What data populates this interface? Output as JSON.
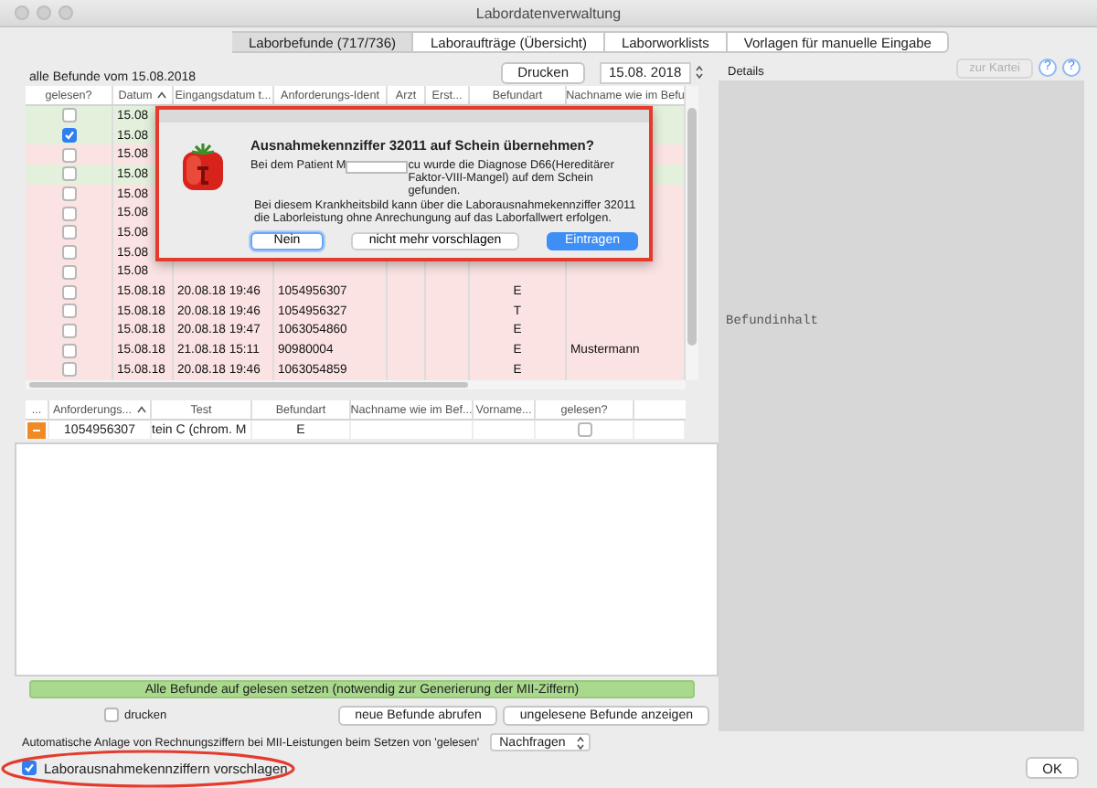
{
  "window": {
    "title": "Labordatenverwaltung"
  },
  "tabs": [
    {
      "label": "Laborbefunde (717/736)",
      "selected": true
    },
    {
      "label": "Laboraufträge (Übersicht)",
      "selected": false
    },
    {
      "label": "Laborworklists",
      "selected": false
    },
    {
      "label": "Vorlagen für manuelle Eingabe",
      "selected": false
    }
  ],
  "results_header": {
    "label": "alle Befunde vom 15.08.2018",
    "print_button": "Drucken",
    "date": "15.08. 2018"
  },
  "results_table": {
    "columns": [
      {
        "label": "gelesen?",
        "sorted": false
      },
      {
        "label": "Datum",
        "sorted": true
      },
      {
        "label": "Eingangsdatum t...",
        "sorted": false
      },
      {
        "label": "Anforderungs-Ident",
        "sorted": false
      },
      {
        "label": "Arzt",
        "sorted": false
      },
      {
        "label": "Erst...",
        "sorted": false
      },
      {
        "label": "Befundart",
        "sorted": false
      },
      {
        "label": "Nachname wie im Befu",
        "sorted": false
      }
    ],
    "rows": [
      {
        "checked": false,
        "color": "#e3f1dc",
        "datum": "15.08"
      },
      {
        "checked": true,
        "color": "#e3f1dc",
        "datum": "15.08"
      },
      {
        "checked": false,
        "color": "#fbe3e3",
        "datum": "15.08"
      },
      {
        "checked": false,
        "color": "#e3f1dc",
        "datum": "15.08"
      },
      {
        "checked": false,
        "color": "#fbe3e3",
        "datum": "15.08"
      },
      {
        "checked": false,
        "color": "#fbe3e3",
        "datum": "15.08"
      },
      {
        "checked": false,
        "color": "#fbe3e3",
        "datum": "15.08"
      },
      {
        "checked": false,
        "color": "#fbe3e3",
        "datum": "15.08"
      },
      {
        "checked": false,
        "color": "#fbe3e3",
        "datum": "15.08"
      },
      {
        "checked": false,
        "color": "#fbe3e3",
        "datum": "15.08.18",
        "eingang": "20.08.18 19:46",
        "ident": "1054956307",
        "befundart": "E"
      },
      {
        "checked": false,
        "color": "#fbe3e3",
        "datum": "15.08.18",
        "eingang": "20.08.18 19:46",
        "ident": "1054956327",
        "befundart": "T"
      },
      {
        "checked": false,
        "color": "#fbe3e3",
        "datum": "15.08.18",
        "eingang": "20.08.18 19:47",
        "ident": "1063054860",
        "befundart": "E"
      },
      {
        "checked": false,
        "color": "#fbe3e3",
        "datum": "15.08.18",
        "eingang": "21.08.18 15:11",
        "ident": "90980004",
        "befundart": "E",
        "nachname": "Mustermann"
      },
      {
        "checked": false,
        "color": "#fbe3e3",
        "datum": "15.08.18",
        "eingang": "20.08.18 19:46",
        "ident": "1063054859",
        "befundart": "E"
      }
    ]
  },
  "orders_table": {
    "columns": [
      {
        "label": "...",
        "sorted": false
      },
      {
        "label": "Anforderungs...",
        "sorted": true
      },
      {
        "label": "Test",
        "sorted": false
      },
      {
        "label": "Befundart",
        "sorted": false
      },
      {
        "label": "Nachname wie im Bef...",
        "sorted": false
      },
      {
        "label": "Vorname...",
        "sorted": false
      },
      {
        "label": "gelesen?",
        "sorted": false
      }
    ],
    "rows": [
      {
        "ident": "1054956307",
        "test": "tein C (chrom. M",
        "befundart": "E",
        "checked": false
      }
    ]
  },
  "mark_all_button": "Alle Befunde auf gelesen setzen (notwendig zur Generierung der MII-Ziffern)",
  "print_checkbox": {
    "label": "drucken",
    "checked": false
  },
  "action_buttons": [
    "neue Befunde abrufen",
    "ungelesene Befunde anzeigen"
  ],
  "details": {
    "label": "Details",
    "kartei_button": {
      "label": "zur Kartei",
      "disabled": true
    },
    "help_buttons": [
      "?",
      "?"
    ],
    "content": "Befundinhalt"
  },
  "auto_billing": {
    "label": "Automatische Anlage von Rechnungsziffern bei MII-Leistungen beim Setzen von 'gelesen'",
    "value": "Nachfragen"
  },
  "suggest_checkbox": {
    "label": "Laborausnahmekennziffern vorschlagen",
    "checked": true
  },
  "ok_button": "OK",
  "dialog": {
    "title": "Ausnahmekennziffer 32011 auf Schein übernehmen?",
    "message_start": "Bei dem Patient M",
    "message_end": "cu wurde die Diagnose D66(Hereditärer Faktor-VIII-Mangel) auf dem Schein gefunden.",
    "note": "Bei diesem Krankheitsbild kann über die Laborausnahmekennziffer 32011 die Laborleistung ohne Anrechungung auf das Laborfallwert erfolgen.",
    "buttons": [
      {
        "label": "Nein",
        "kind": "focused"
      },
      {
        "label": "nicht mehr vorschlagen",
        "kind": "normal"
      },
      {
        "label": "Eintragen",
        "kind": "default"
      }
    ]
  }
}
